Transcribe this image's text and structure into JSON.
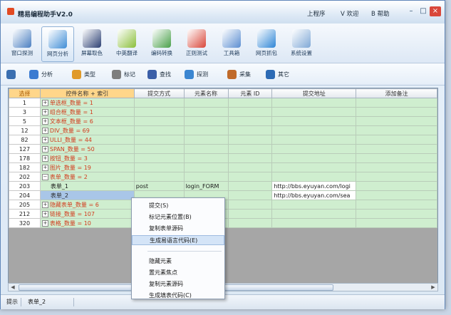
{
  "window": {
    "title": "精易编程助手V2.0",
    "menus": [
      "上程序",
      "V 欢迎",
      "B 帮助"
    ],
    "controls": [
      "–",
      "□",
      "×"
    ]
  },
  "toolbar": {
    "items": [
      {
        "label": "窗口探测",
        "icon": "window-probe-icon",
        "color": "#4a7fc1"
      },
      {
        "label": "网页分析",
        "icon": "web-analysis-icon",
        "color": "#3f8dd6"
      },
      {
        "label": "屏幕取色",
        "icon": "color-picker-icon",
        "color": "#2b3f73"
      },
      {
        "label": "中英翻译",
        "icon": "translate-icon",
        "color": "#8bbf3a"
      },
      {
        "label": "编码转换",
        "icon": "encode-convert-icon",
        "color": "#4aa04a"
      },
      {
        "label": "正则测试",
        "icon": "regex-test-icon",
        "color": "#d9473a"
      },
      {
        "label": "工具箱",
        "icon": "toolbox-icon",
        "color": "#5b8ed1"
      },
      {
        "label": "网页抓包",
        "icon": "capture-icon",
        "color": "#2f86d6"
      },
      {
        "label": "系统设置",
        "icon": "settings-icon",
        "color": "#7fa8d6"
      }
    ]
  },
  "subtoolbar": {
    "items": [
      {
        "label": "",
        "icon": "crosshair-icon",
        "color": "#3b6fb0"
      },
      {
        "label": "分析",
        "icon": "magnifier-icon",
        "color": "#3b7bd1"
      },
      {
        "label": "类型",
        "icon": "type-icon",
        "color": "#e09a2a"
      },
      {
        "label": "标记",
        "icon": "mark-icon",
        "color": "#7e7e7e"
      },
      {
        "label": "查找",
        "icon": "find-icon",
        "color": "#3b5fa8"
      },
      {
        "label": "探测",
        "icon": "detect-icon",
        "color": "#3b86d1"
      },
      {
        "label": "采集",
        "icon": "collect-icon",
        "color": "#c06a2a"
      },
      {
        "label": "其它",
        "icon": "other-icon",
        "color": "#2d6bb5"
      }
    ]
  },
  "grid": {
    "columns": [
      "选择",
      "控件名称 + 索引",
      "提交方式",
      "元素名称",
      "元素 ID",
      "提交地址",
      "添加备注"
    ],
    "rows": [
      {
        "index": "1",
        "name": "单选框_数量 = 1",
        "method": "",
        "element": "",
        "url": "",
        "leaf": false
      },
      {
        "index": "3",
        "name": "组合框_数量 = 1",
        "method": "",
        "element": "",
        "url": "",
        "leaf": false
      },
      {
        "index": "5",
        "name": "文本框_数量 = 6",
        "method": "",
        "element": "",
        "url": "",
        "leaf": false
      },
      {
        "index": "12",
        "name": "DIV_数量 = 69",
        "method": "",
        "element": "",
        "url": "",
        "leaf": false
      },
      {
        "index": "82",
        "name": "ULLI_数量 = 44",
        "method": "",
        "element": "",
        "url": "",
        "leaf": false
      },
      {
        "index": "127",
        "name": "SPAN_数量 = 50",
        "method": "",
        "element": "",
        "url": "",
        "leaf": false
      },
      {
        "index": "178",
        "name": "按钮_数量 = 3",
        "method": "",
        "element": "",
        "url": "",
        "leaf": false
      },
      {
        "index": "182",
        "name": "图片_数量 = 19",
        "method": "",
        "element": "",
        "url": "",
        "leaf": false
      },
      {
        "index": "202",
        "name": "表单_数量 = 2",
        "method": "",
        "element": "",
        "url": "",
        "leaf": false
      },
      {
        "index": "203",
        "name": "表单_1",
        "method": "post",
        "element": "login_FORM",
        "url": "http://bbs.eyuyan.com/logi",
        "leaf": true
      },
      {
        "index": "204",
        "name": "表单_2",
        "method": "",
        "element": "",
        "url": "http://bbs.eyuyan.com/sea",
        "leaf": true,
        "selected": true
      },
      {
        "index": "205",
        "name": "隐藏表单_数量 = 6",
        "method": "",
        "element": "",
        "url": "",
        "leaf": false
      },
      {
        "index": "212",
        "name": "链接_数量 = 107",
        "method": "",
        "element": "",
        "url": "",
        "leaf": false
      },
      {
        "index": "320",
        "name": "表格_数量 = 10",
        "method": "",
        "element": "",
        "url": "",
        "leaf": false
      }
    ]
  },
  "context_menu": {
    "group1": [
      "提交(S)",
      "标记元素位置(B)",
      "复制表单源码",
      "生成易语言代码(E)"
    ],
    "group2": [
      "隐藏元素",
      "置元素焦点",
      "复制元素源码",
      "生成填表代码(C)"
    ],
    "highlighted": 3
  },
  "status": {
    "label": "提示",
    "value": "表单_2"
  }
}
